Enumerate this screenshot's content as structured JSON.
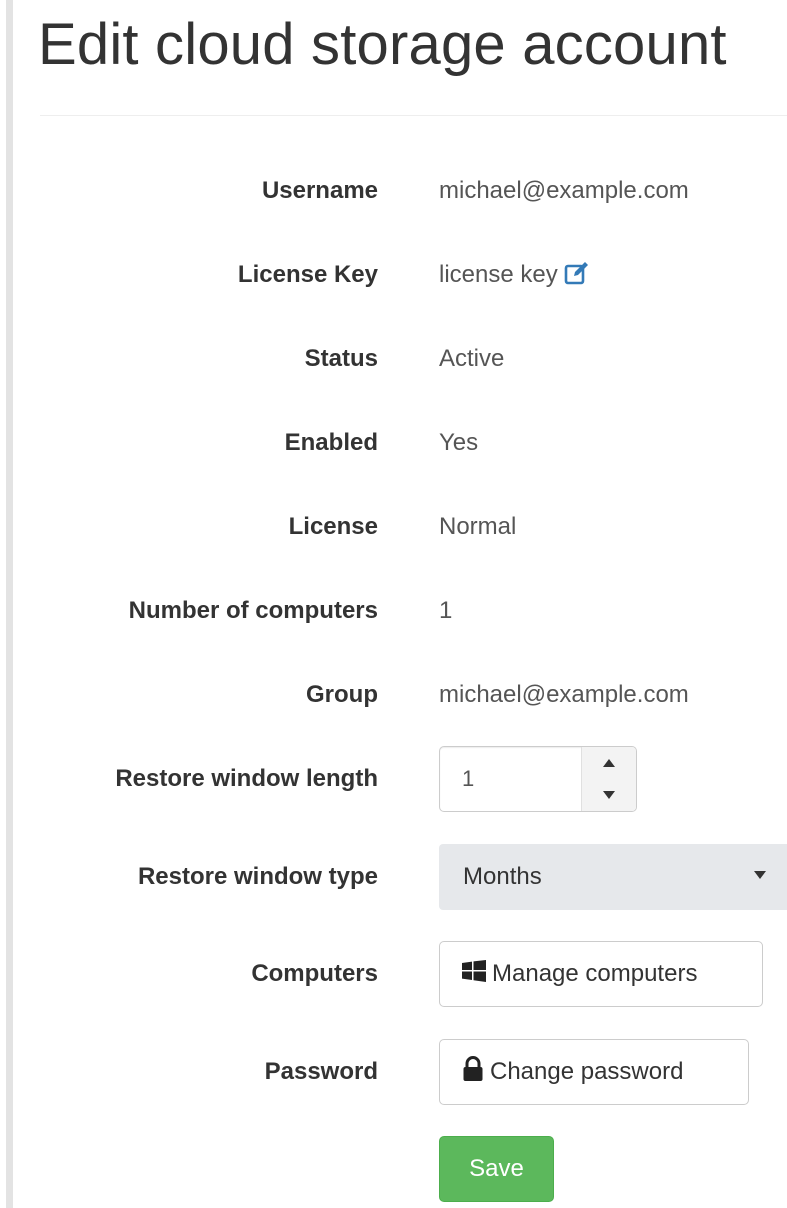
{
  "page": {
    "title": "Edit cloud storage account"
  },
  "fields": {
    "username": {
      "label": "Username",
      "value": "michael@example.com"
    },
    "license_key": {
      "label": "License Key",
      "value": "license key"
    },
    "status": {
      "label": "Status",
      "value": "Active"
    },
    "enabled": {
      "label": "Enabled",
      "value": "Yes"
    },
    "license": {
      "label": "License",
      "value": "Normal"
    },
    "num_computers": {
      "label": "Number of computers",
      "value": "1"
    },
    "group": {
      "label": "Group",
      "value": "michael@example.com"
    },
    "restore_length": {
      "label": "Restore window length",
      "value": "1"
    },
    "restore_type": {
      "label": "Restore window type",
      "value": "Months"
    },
    "computers": {
      "label": "Computers",
      "button": "Manage computers"
    },
    "password": {
      "label": "Password",
      "button": "Change password"
    }
  },
  "actions": {
    "save_label": "Save"
  },
  "colors": {
    "accent": "#337ab7",
    "save": "#5cb85c",
    "select_bg": "#e6e8eb"
  },
  "icons": [
    "edit-icon",
    "windows-icon",
    "lock-icon",
    "caret-up-icon",
    "caret-down-icon",
    "caret-down-icon"
  ]
}
